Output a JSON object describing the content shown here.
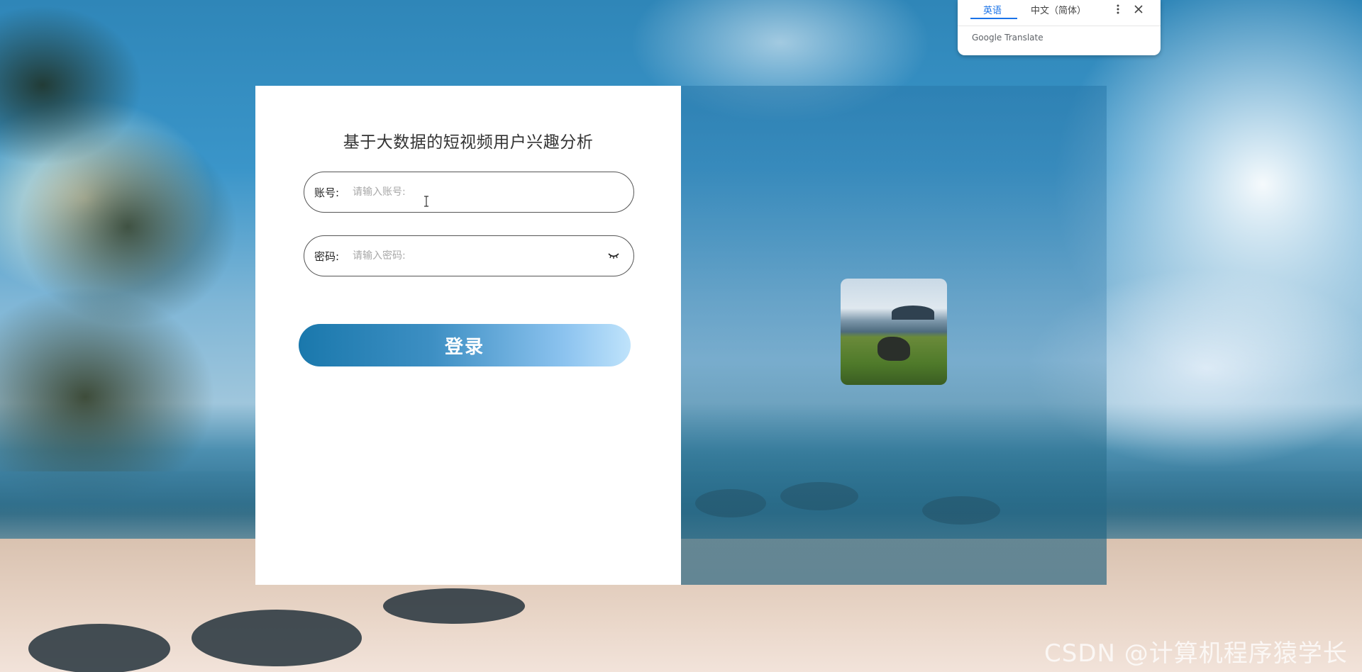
{
  "login": {
    "title": "基于大数据的短视频用户兴趣分析",
    "username_label": "账号:",
    "username_placeholder": "请输入账号:",
    "password_label": "密码:",
    "password_placeholder": "请输入密码:",
    "login_button": "登录"
  },
  "translate_popup": {
    "tab_english": "英语",
    "tab_chinese": "中文（简体）",
    "brand": "Google Translate"
  },
  "watermark": "CSDN @计算机程序猿学长",
  "colors": {
    "button_start": "#1a78ac",
    "button_end": "#bfe3fb",
    "accent": "#1a73e8"
  },
  "icons": {
    "password_toggle": "eye-closed-icon",
    "menu": "more-vert-icon",
    "close": "close-icon"
  }
}
